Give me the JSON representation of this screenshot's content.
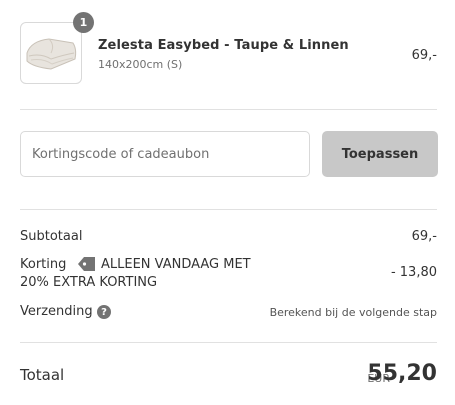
{
  "cart": {
    "item_count": "1",
    "product_name": "Zelesta Easybed - Taupe & Linnen",
    "product_variant": "140x200cm (S)",
    "product_price": "69,-"
  },
  "discount_form": {
    "placeholder": "Kortingscode of cadeaubon",
    "apply_label": "Toepassen"
  },
  "summary": {
    "subtotal_label": "Subtotaal",
    "subtotal_value": "69,-",
    "discount_label": "Korting",
    "discount_code_line1": "ALLEEN VANDAAG MET",
    "discount_code_line2": "20% EXTRA KORTING",
    "discount_value": "- 13,80",
    "shipping_label": "Verzending",
    "shipping_value": "Berekend bij de volgende stap",
    "shipping_help_icon": "help-circle-icon"
  },
  "total": {
    "label": "Totaal",
    "currency": "EUR",
    "value": "55,20"
  },
  "colors": {
    "badge": "#737373",
    "button_bg": "#c8c8c8",
    "divider": "#e1e1e1"
  }
}
